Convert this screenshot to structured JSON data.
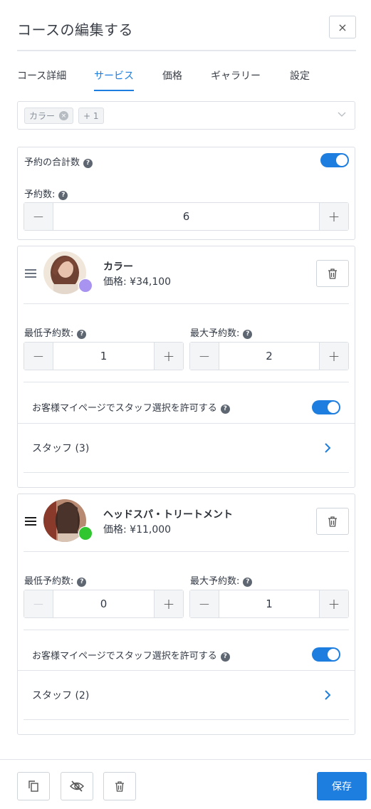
{
  "header": {
    "title": "コースの編集する",
    "close_label": "×"
  },
  "tabs": [
    {
      "label": "コース詳細"
    },
    {
      "label": "サービス"
    },
    {
      "label": "価格"
    },
    {
      "label": "ギャラリー"
    },
    {
      "label": "設定"
    }
  ],
  "active_tab": "サービス",
  "service_select": {
    "chips": [
      {
        "label": "カラー",
        "remove": "×"
      },
      {
        "label": "+ 1"
      }
    ]
  },
  "booking_total": {
    "toggle_label": "予約の合計数",
    "toggle_on": true,
    "count_label": "予約数:",
    "count_value": "6",
    "minus": "−",
    "plus": "+"
  },
  "services": [
    {
      "name": "カラー",
      "price": "価格: ¥34,100",
      "status_color": "#a893f0",
      "min_label": "最低予約数:",
      "min_value": "1",
      "max_label": "最大予約数:",
      "max_value": "2",
      "allow_staff_label": "お客様マイページでスタッフ選択を許可する",
      "allow_staff_on": true,
      "staff_label": "スタッフ (3)",
      "minus": "−",
      "plus": "+"
    },
    {
      "name": "ヘッドスパ・トリートメント",
      "price": "価格: ¥11,000",
      "status_color": "#2fc62f",
      "min_label": "最低予約数:",
      "min_value": "0",
      "max_label": "最大予約数:",
      "max_value": "1",
      "allow_staff_label": "お客様マイページでスタッフ選択を許可する",
      "allow_staff_on": true,
      "staff_label": "スタッフ (2)",
      "minus": "−",
      "plus": "+"
    }
  ],
  "footer": {
    "save_label": "保存"
  },
  "colors": {
    "accent": "#1e7ee0",
    "border": "#dcdfe3",
    "text": "#333a45"
  },
  "icons": [
    "close-icon",
    "chevron-down-icon",
    "help-icon",
    "drag-handle-icon",
    "trash-icon",
    "chevron-right-icon",
    "copy-icon",
    "eye-off-icon"
  ]
}
